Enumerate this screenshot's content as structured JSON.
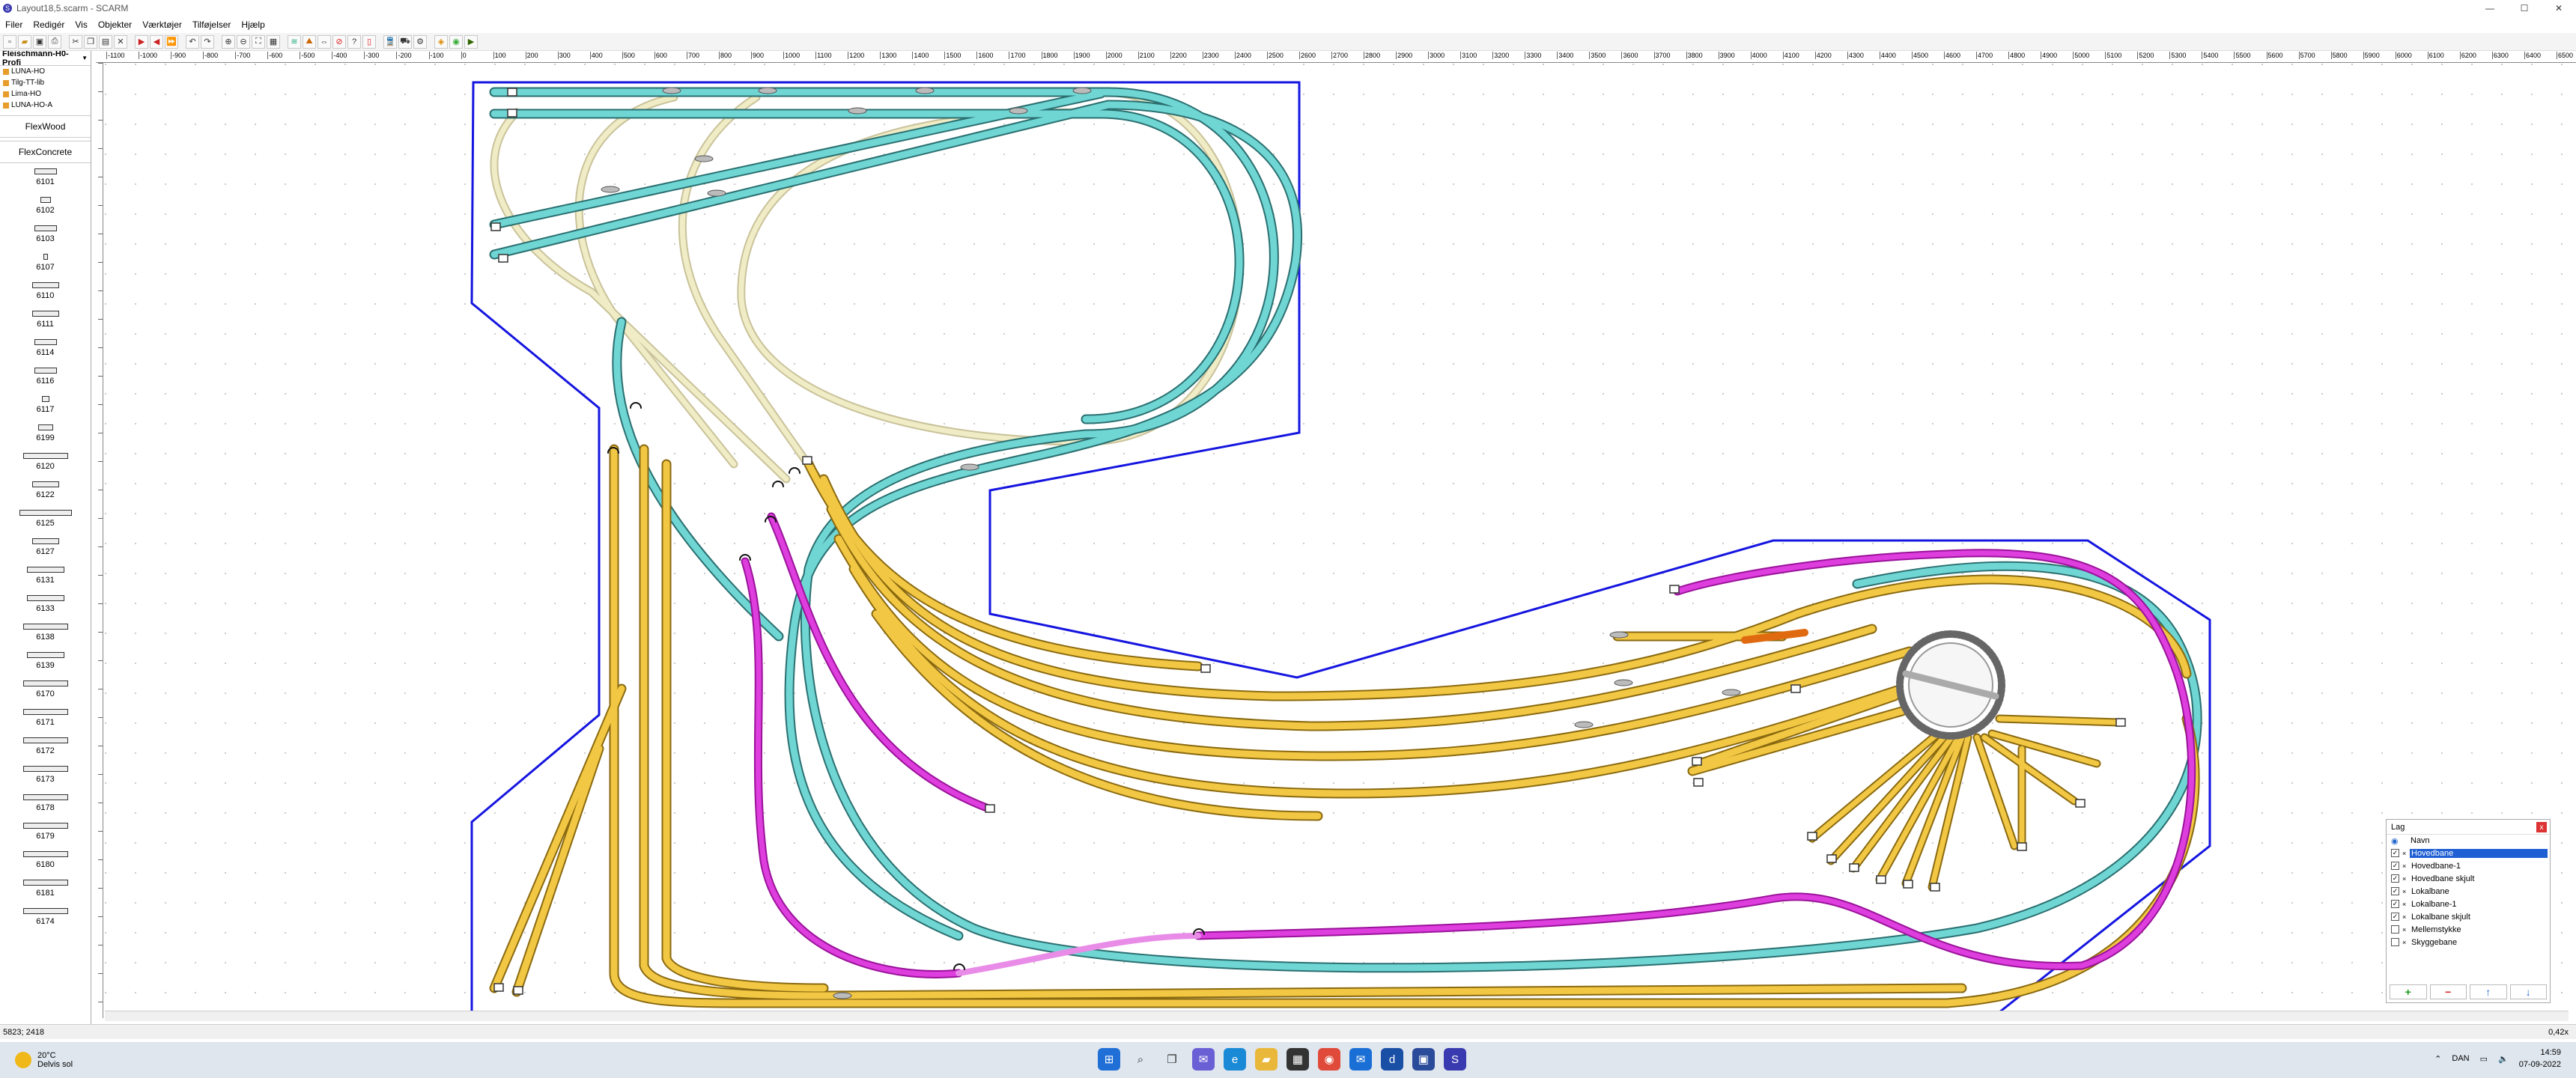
{
  "window": {
    "title": "Layout18,5.scarm - SCARM",
    "minimize": "—",
    "maximize": "☐",
    "close": "✕"
  },
  "menu": [
    "Filer",
    "Redigér",
    "Vis",
    "Objekter",
    "Værktøjer",
    "Tilføjelser",
    "Hjælp"
  ],
  "sidebar": {
    "library_selector": "Fleischmann-H0-Profi",
    "libraries": [
      "LUNA-HO",
      "Tilg-TT-lib",
      "Lima-HO",
      "LUNA-HO-A"
    ],
    "flex_wood": "FlexWood",
    "flex_concrete": "FlexConcrete",
    "parts": [
      "6101",
      "6102",
      "6103",
      "6107",
      "6110",
      "6111",
      "6114",
      "6116",
      "6117",
      "6199",
      "6120",
      "6122",
      "6125",
      "6127",
      "6131",
      "6133",
      "6138",
      "6139",
      "6170",
      "6171",
      "6172",
      "6173",
      "6178",
      "6179",
      "6180",
      "6181",
      "6174"
    ]
  },
  "ruler": {
    "ticks": [
      "-1100",
      "-1000",
      "-900",
      "-800",
      "-700",
      "-600",
      "-500",
      "-400",
      "-300",
      "-200",
      "-100",
      "0",
      "100",
      "200",
      "300",
      "400",
      "500",
      "600",
      "700",
      "800",
      "900",
      "1000",
      "1100",
      "1200",
      "1300",
      "1400",
      "1500",
      "1600",
      "1700",
      "1800",
      "1900",
      "2000",
      "2100",
      "2200",
      "2300",
      "2400",
      "2500",
      "2600",
      "2700",
      "2800",
      "2900",
      "3000",
      "3100",
      "3200",
      "3300",
      "3400",
      "3500",
      "3600",
      "3700",
      "3800",
      "3900",
      "4000",
      "4100",
      "4200",
      "4300",
      "4400",
      "4500",
      "4600",
      "4700",
      "4800",
      "4900",
      "5000",
      "5100",
      "5200",
      "5300",
      "5400",
      "5500",
      "5600",
      "5700",
      "5800",
      "5900",
      "6000",
      "6100",
      "6200",
      "6300",
      "6400",
      "6500"
    ],
    "unit": "mm"
  },
  "layers": {
    "title": "Lag",
    "close": "x",
    "column": "Navn",
    "items": [
      {
        "name": "Hovedbane",
        "checked": true,
        "selected": true
      },
      {
        "name": "Hovedbane-1",
        "checked": true,
        "selected": false
      },
      {
        "name": "Hovedbane skjult",
        "checked": true,
        "selected": false
      },
      {
        "name": "Lokalbane",
        "checked": true,
        "selected": false
      },
      {
        "name": "Lokalbane-1",
        "checked": true,
        "selected": false
      },
      {
        "name": "Lokalbane skjult",
        "checked": true,
        "selected": false
      },
      {
        "name": "Mellemstykke",
        "checked": false,
        "selected": false
      },
      {
        "name": "Skyggebane",
        "checked": false,
        "selected": false
      }
    ],
    "add": "+",
    "remove": "−",
    "up": "↑",
    "down": "↓"
  },
  "status": {
    "coords": "5823; 2418",
    "zoom": "0,42x"
  },
  "taskbar": {
    "temp": "20°C",
    "weather": "Delvis sol",
    "lang": "DAN",
    "time": "14:59",
    "date": "07-09-2022"
  },
  "colors": {
    "mainline": "#5fd0d0",
    "local": "#f2c744",
    "branch": "#cc22cc",
    "hidden": "#e8e2a8",
    "border": "#1515e0",
    "accent": "#1e5fd3"
  }
}
